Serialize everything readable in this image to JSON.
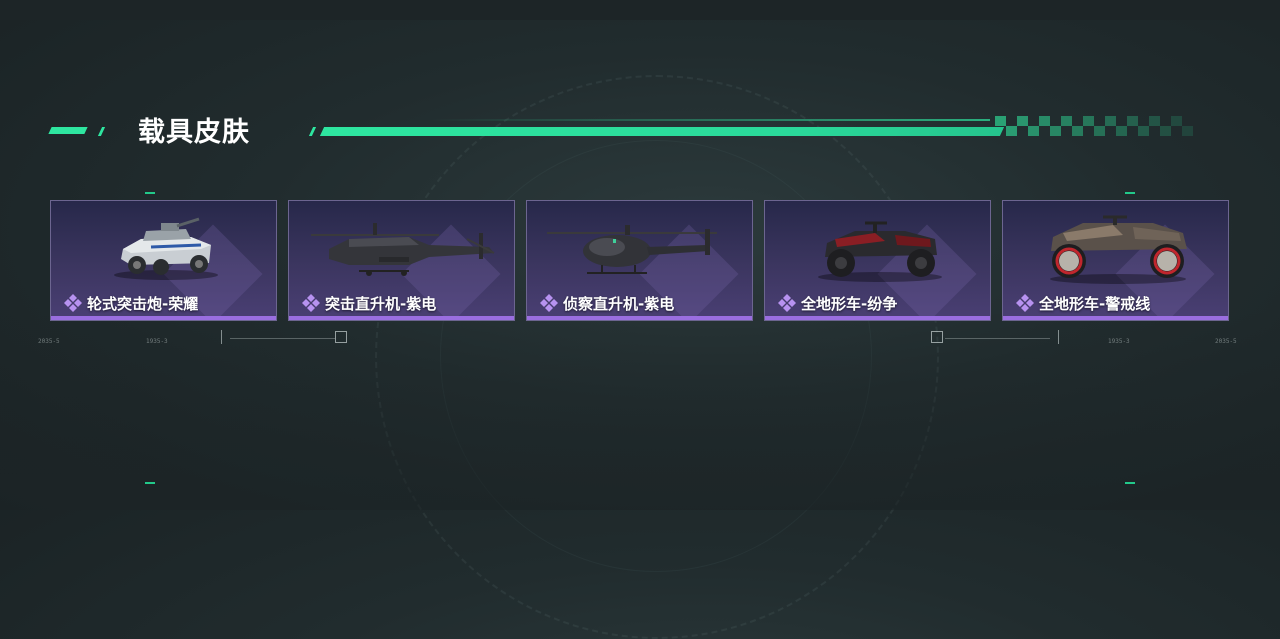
{
  "section": {
    "title": "载具皮肤"
  },
  "skins": [
    {
      "name": "轮式突击炮-荣耀",
      "vehicle_icon": "armored-car-icon"
    },
    {
      "name": "突击直升机-紫电",
      "vehicle_icon": "attack-helicopter-icon"
    },
    {
      "name": "侦察直升机-紫电",
      "vehicle_icon": "scout-helicopter-icon"
    },
    {
      "name": "全地形车-纷争",
      "vehicle_icon": "atv-icon"
    },
    {
      "name": "全地形车-警戒线",
      "vehicle_icon": "atv-rusty-icon"
    }
  ],
  "hud": {
    "left_code_a": "2035-5",
    "left_code_b": "1935-3",
    "right_code_a": "1935-3",
    "right_code_b": "2035-5"
  },
  "colors": {
    "accent_green": "#2ee6a0",
    "card_border": "#6c6590",
    "rarity_purple": "#9a6ee0"
  }
}
